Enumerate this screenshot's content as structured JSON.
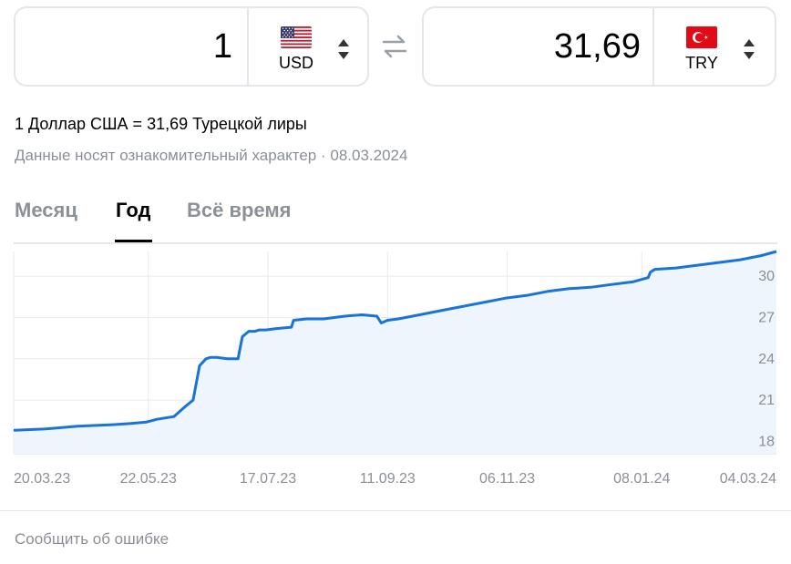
{
  "converter": {
    "from": {
      "amount": "1",
      "currency": "USD",
      "flag": "us-flag-icon"
    },
    "to": {
      "amount": "31,69",
      "currency": "TRY",
      "flag": "tr-flag-icon"
    },
    "swap_icon": "swap-arrows-icon"
  },
  "rate_text": "1 Доллар США = 31,69 Турецкой лиры",
  "disclaimer": "Данные носят ознакомительный характер · 08.03.2024",
  "tabs": [
    {
      "label": "Месяц",
      "active": false
    },
    {
      "label": "Год",
      "active": true
    },
    {
      "label": "Всё время",
      "active": false
    }
  ],
  "report_link": "Сообщить об ошибке",
  "colors": {
    "line": "#1a73d9",
    "fill": "#eef5fc",
    "muted": "#8a8f96",
    "grid": "#e8eaed"
  },
  "chart_data": {
    "type": "area",
    "x_ticks": [
      "20.03.23",
      "22.05.23",
      "17.07.23",
      "11.09.23",
      "06.11.23",
      "08.01.24",
      "04.03.24"
    ],
    "y_ticks": [
      "18",
      "21",
      "24",
      "27",
      "30"
    ],
    "y_tick_values": [
      18,
      21,
      24,
      27,
      30
    ],
    "ylim": [
      17.1,
      31.8
    ],
    "x_range_days": [
      0,
      357
    ],
    "tick_days": [
      0,
      63,
      119,
      175,
      231,
      294,
      350
    ],
    "series": [
      {
        "x": [
          0,
          15,
          30,
          45,
          55,
          62,
          67,
          75,
          80,
          84,
          87,
          90,
          92,
          95,
          100,
          105,
          107,
          110,
          113,
          115,
          118,
          123,
          130,
          131,
          137,
          145,
          150,
          155,
          163,
          170,
          172,
          175,
          180,
          190,
          200,
          210,
          220,
          230,
          240,
          250,
          260,
          270,
          280,
          290,
          297,
          298,
          300,
          310,
          320,
          330,
          340,
          350,
          357
        ],
        "y": [
          18.8,
          18.9,
          19.1,
          19.2,
          19.3,
          19.4,
          19.6,
          19.8,
          20.5,
          21.0,
          23.5,
          24.0,
          24.1,
          24.1,
          24.0,
          24.0,
          25.6,
          26.0,
          26.0,
          26.1,
          26.1,
          26.2,
          26.3,
          26.8,
          26.9,
          26.9,
          27.0,
          27.1,
          27.2,
          27.1,
          26.6,
          26.8,
          26.9,
          27.2,
          27.5,
          27.8,
          28.1,
          28.4,
          28.6,
          28.9,
          29.1,
          29.2,
          29.4,
          29.6,
          29.9,
          30.3,
          30.5,
          30.6,
          30.8,
          31.0,
          31.2,
          31.5,
          31.8
        ]
      }
    ],
    "grid": true
  }
}
